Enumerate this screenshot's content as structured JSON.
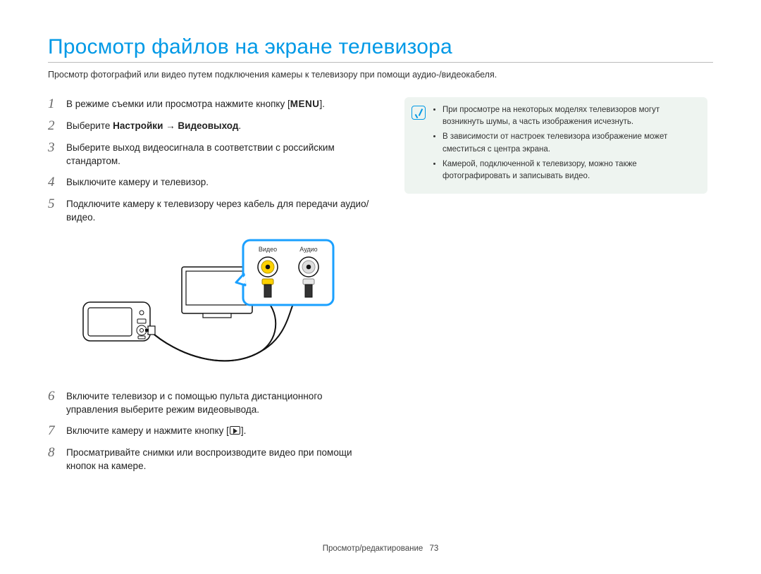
{
  "title": "Просмотр файлов на экране телевизора",
  "intro": "Просмотр фотографий или видео путем подключения камеры к телевизору при помощи аудио-/видеокабеля.",
  "steps": {
    "s1_pre": "В режиме съемки или просмотра нажмите кнопку [",
    "s1_menu": "MENU",
    "s1_post": "].",
    "s2_pre": "Выберите ",
    "s2_b1": "Настройки",
    "s2_arrow": " → ",
    "s2_b2": "Видеовыход",
    "s2_post": ".",
    "s3": "Выберите выход видеосигнала в соответствии с российским стандартом.",
    "s4": "Выключите камеру и телевизор.",
    "s5": "Подключите камеру к телевизору через кабель для передачи аудио/видео.",
    "s6": "Включите телевизор и с помощью пульта дистанционного управления выберите режим видеовывода.",
    "s7_pre": "Включите камеру и нажмите кнопку [",
    "s7_post": "].",
    "s8": "Просматривайте снимки или воспроизводите видео при помощи кнопок на камере."
  },
  "diagram": {
    "video_label": "Видео",
    "audio_label": "Аудио"
  },
  "notes": {
    "n1": "При просмотре на некоторых моделях телевизоров могут возникнуть шумы, а часть изображения исчезнуть.",
    "n2": "В зависимости от настроек телевизора изображение может сместиться с центра экрана.",
    "n3": "Камерой, подключенной к телевизору, можно также фотографировать и записывать видео."
  },
  "footer": {
    "section": "Просмотр/редактирование",
    "page": "73"
  }
}
